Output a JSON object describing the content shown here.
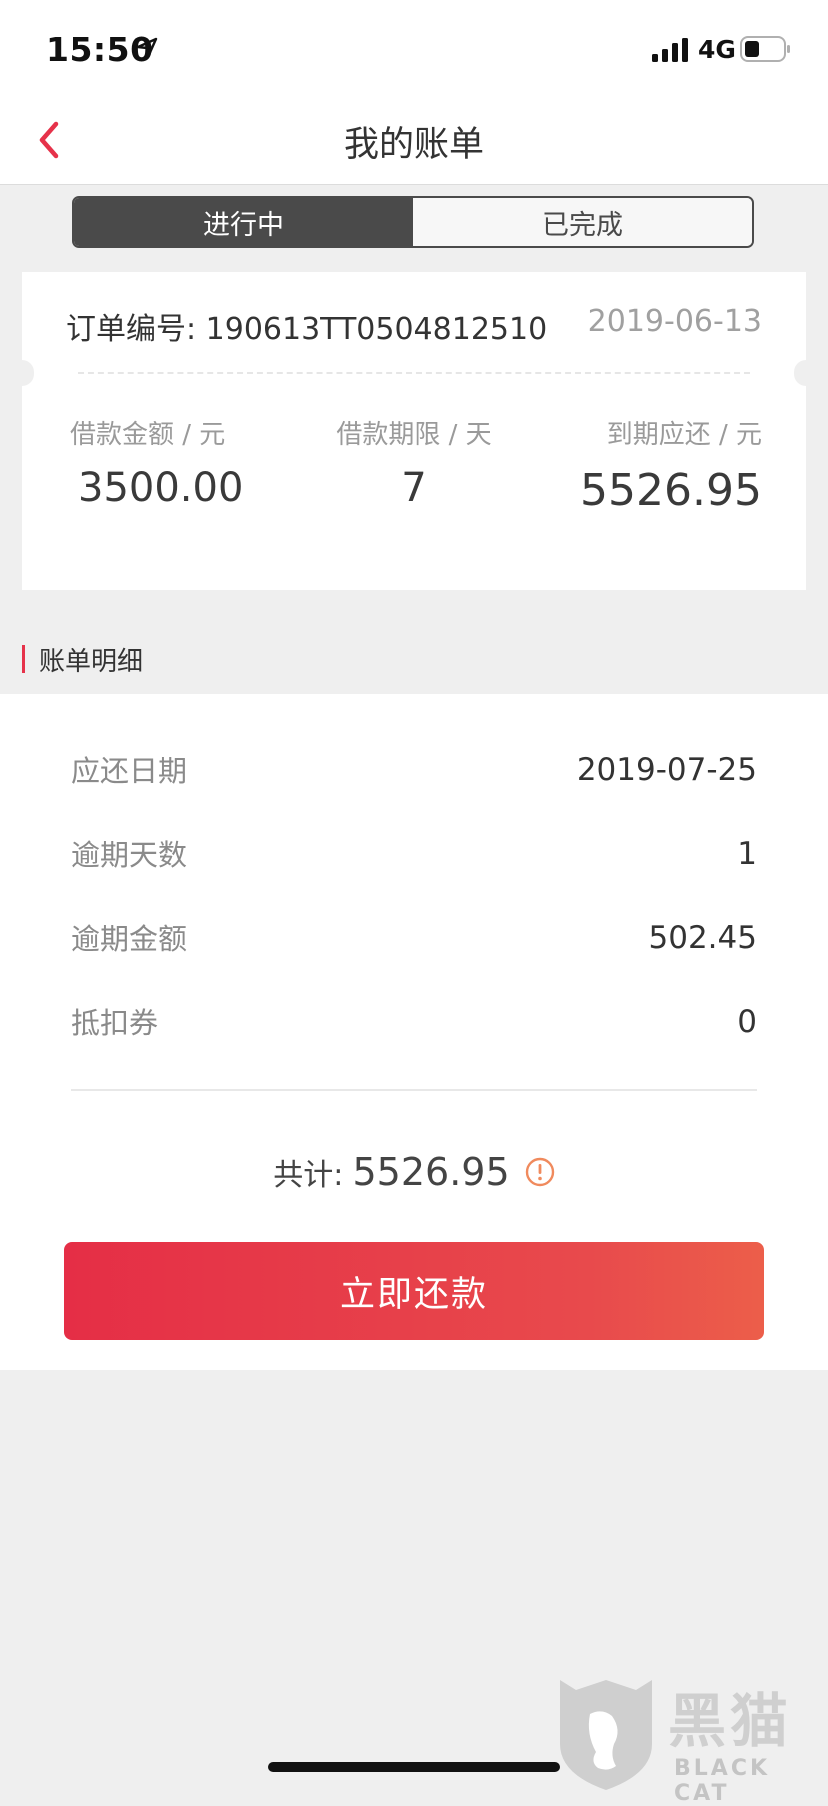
{
  "status_bar": {
    "time": "15:50",
    "network": "4G",
    "icons": [
      "location-arrow-icon",
      "signal-bars-icon",
      "battery-icon"
    ]
  },
  "nav": {
    "title": "我的账单",
    "back_icon": "chevron-left-icon",
    "accent_color": "#e6324a"
  },
  "tabs": [
    {
      "label": "进行中",
      "active": true
    },
    {
      "label": "已完成",
      "active": false
    }
  ],
  "order": {
    "number_label": "订单编号:",
    "number": "190613TT0504812510",
    "date": "2019-06-13",
    "stats": [
      {
        "label": "借款金额 / 元",
        "value": "3500.00"
      },
      {
        "label": "借款期限 / 天",
        "value": "7"
      },
      {
        "label": "到期应还 / 元",
        "value": "5526.95"
      }
    ]
  },
  "section": {
    "title": "账单明细"
  },
  "details": [
    {
      "label": "应还日期",
      "value": "2019-07-25"
    },
    {
      "label": "逾期天数",
      "value": "1"
    },
    {
      "label": "逾期金额",
      "value": "502.45"
    },
    {
      "label": "抵扣券",
      "value": "0"
    }
  ],
  "total": {
    "label": "共计:",
    "value": "5526.95",
    "icon": "info-circle-icon",
    "icon_color": "#f08a5d"
  },
  "pay_button": {
    "label": "立即还款",
    "gradient": [
      "#e52e46",
      "#ec5e4a"
    ]
  },
  "watermark": {
    "title": "黑猫",
    "subtitle": "BLACK CAT"
  }
}
